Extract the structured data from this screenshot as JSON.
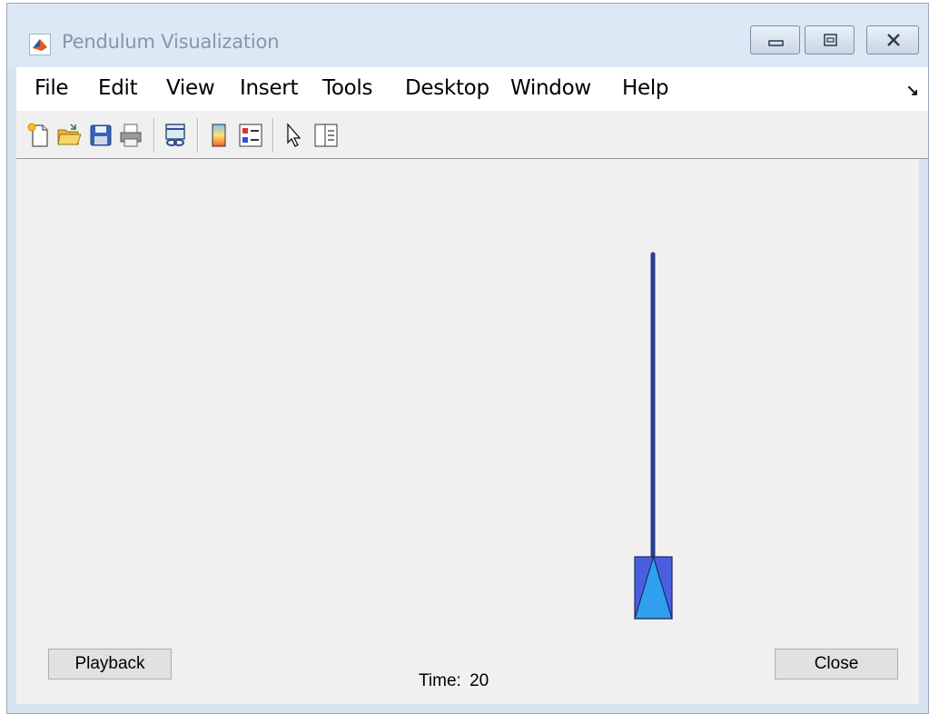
{
  "window": {
    "title": "Pendulum Visualization"
  },
  "menu": [
    "File",
    "Edit",
    "View",
    "Insert",
    "Tools",
    "Desktop",
    "Window",
    "Help"
  ],
  "toolbar": {
    "icons": [
      "new-figure-icon",
      "open-file-icon",
      "save-icon",
      "print-icon",
      "link-plot-icon",
      "colorbar-icon",
      "legend-icon",
      "pointer-icon",
      "property-editor-icon"
    ]
  },
  "figure": {
    "time_prefix": "Time:",
    "time_value": "20",
    "playback_label": "Playback",
    "close_label": "Close",
    "pendulum_angle_deg": 0
  },
  "colors": {
    "rod": "#2a3d8f",
    "cart_body": "#4a5fe0",
    "cart_triangle": "#2ea0ee",
    "figure_bg": "#f0f0f0"
  }
}
